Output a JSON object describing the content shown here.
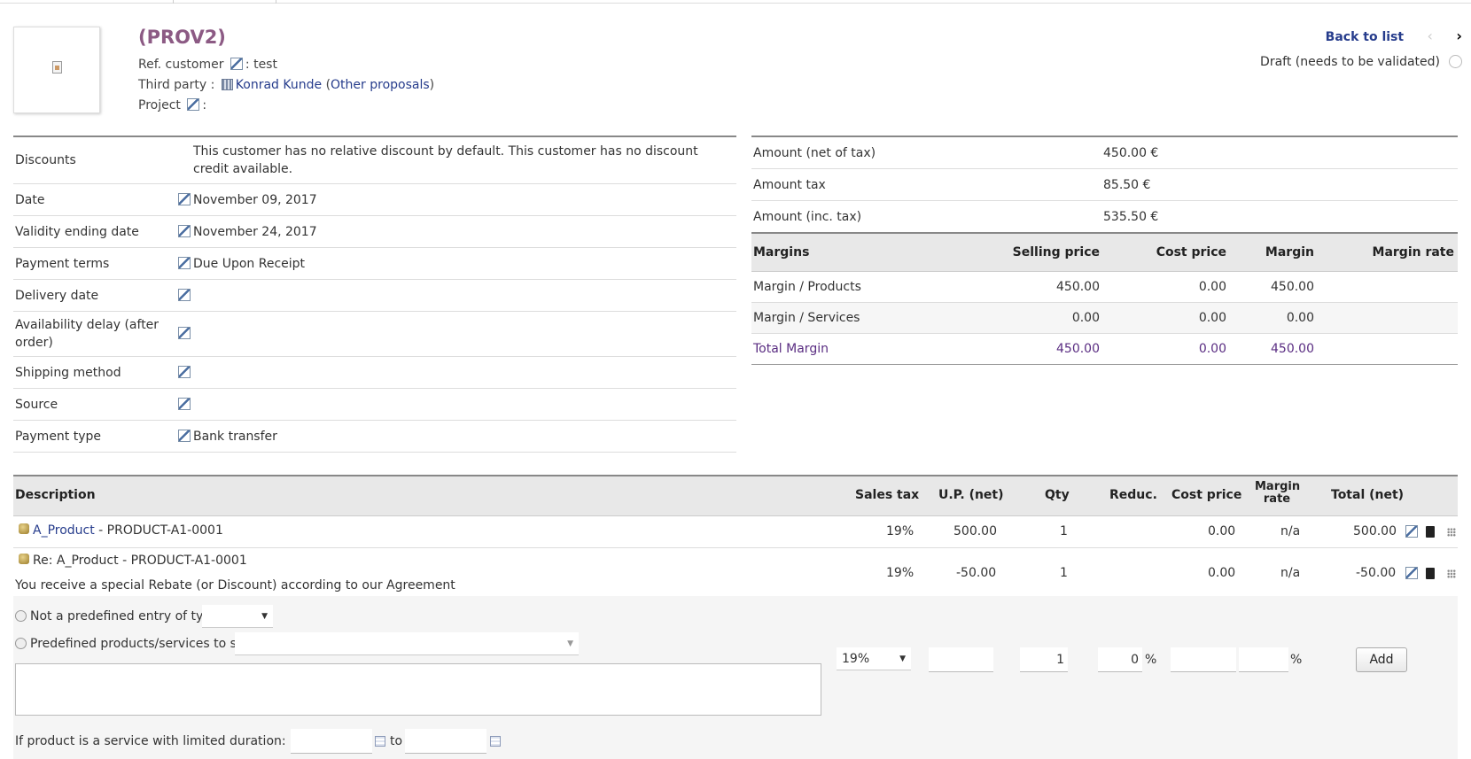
{
  "header": {
    "ref": "(PROV2)",
    "ref_customer_label": "Ref. customer",
    "ref_customer_value": ": test",
    "third_party_label": "Third party :",
    "third_party_name": "Konrad Kunde",
    "other_proposals_open": "(",
    "other_proposals": "Other proposals",
    "other_proposals_close": ")",
    "project_label": "Project",
    "project_value": ":"
  },
  "nav": {
    "back": "Back to list",
    "prev": "‹",
    "next": "›",
    "status": "Draft (needs to be validated)"
  },
  "fields": [
    {
      "label": "Discounts",
      "value": "This customer has no relative discount by default. This customer has no discount credit available.",
      "editable": false
    },
    {
      "label": "Date",
      "value": "November 09, 2017",
      "editable": true
    },
    {
      "label": "Validity ending date",
      "value": "November 24, 2017",
      "editable": true
    },
    {
      "label": "Payment terms",
      "value": "Due Upon Receipt",
      "editable": true
    },
    {
      "label": "Delivery date",
      "value": "",
      "editable": true
    },
    {
      "label": "Availability delay (after order)",
      "value": "",
      "editable": true
    },
    {
      "label": "Shipping method",
      "value": "",
      "editable": true
    },
    {
      "label": "Source",
      "value": "",
      "editable": true
    },
    {
      "label": "Payment type",
      "value": "Bank transfer",
      "editable": true
    }
  ],
  "amounts": [
    {
      "label": "Amount (net of tax)",
      "value": "450.00 €"
    },
    {
      "label": "Amount tax",
      "value": "85.50 €"
    },
    {
      "label": "Amount (inc. tax)",
      "value": "535.50 €"
    }
  ],
  "margins": {
    "headers": [
      "Margins",
      "Selling price",
      "Cost price",
      "Margin",
      "Margin rate"
    ],
    "rows": [
      [
        "Margin / Products",
        "450.00",
        "0.00",
        "450.00",
        ""
      ],
      [
        "Margin / Services",
        "0.00",
        "0.00",
        "0.00",
        ""
      ],
      [
        "Total Margin",
        "450.00",
        "0.00",
        "450.00",
        ""
      ]
    ]
  },
  "lines": {
    "headers": {
      "description": "Description",
      "sales_tax": "Sales tax",
      "up_net": "U.P. (net)",
      "qty": "Qty",
      "reduc": "Reduc.",
      "cost_price": "Cost price",
      "margin_rate_1": "Margin",
      "margin_rate_2": "rate",
      "total_net": "Total (net)"
    },
    "rows": [
      {
        "product_link": "A_Product",
        "product_rest": " - PRODUCT-A1-0001",
        "desc": "",
        "tax": "19%",
        "up": "500.00",
        "qty": "1",
        "reduc": "",
        "cost": "0.00",
        "rate": "n/a",
        "total": "500.00"
      },
      {
        "product_link": "",
        "product_rest": "Re: A_Product - PRODUCT-A1-0001",
        "desc": "You receive a special Rebate (or Discount) according to our Agreement",
        "tax": "19%",
        "up": "-50.00",
        "qty": "1",
        "reduc": "",
        "cost": "0.00",
        "rate": "n/a",
        "total": "-50.00"
      }
    ]
  },
  "addform": {
    "free_entry_label": "Not a predefined entry of type",
    "free_entry_type": "",
    "predefined_label": "Predefined products/services to sell",
    "predefined_value": "",
    "tax_value": "19%",
    "up_value": "",
    "qty_value": "1",
    "reduc_value": "0",
    "reduc_unit": "%",
    "cost_value": "",
    "rate_value": "",
    "rate_unit": "%",
    "add_button": "Add",
    "service_label": "If product is a service with limited duration: From",
    "to_label": "to"
  }
}
